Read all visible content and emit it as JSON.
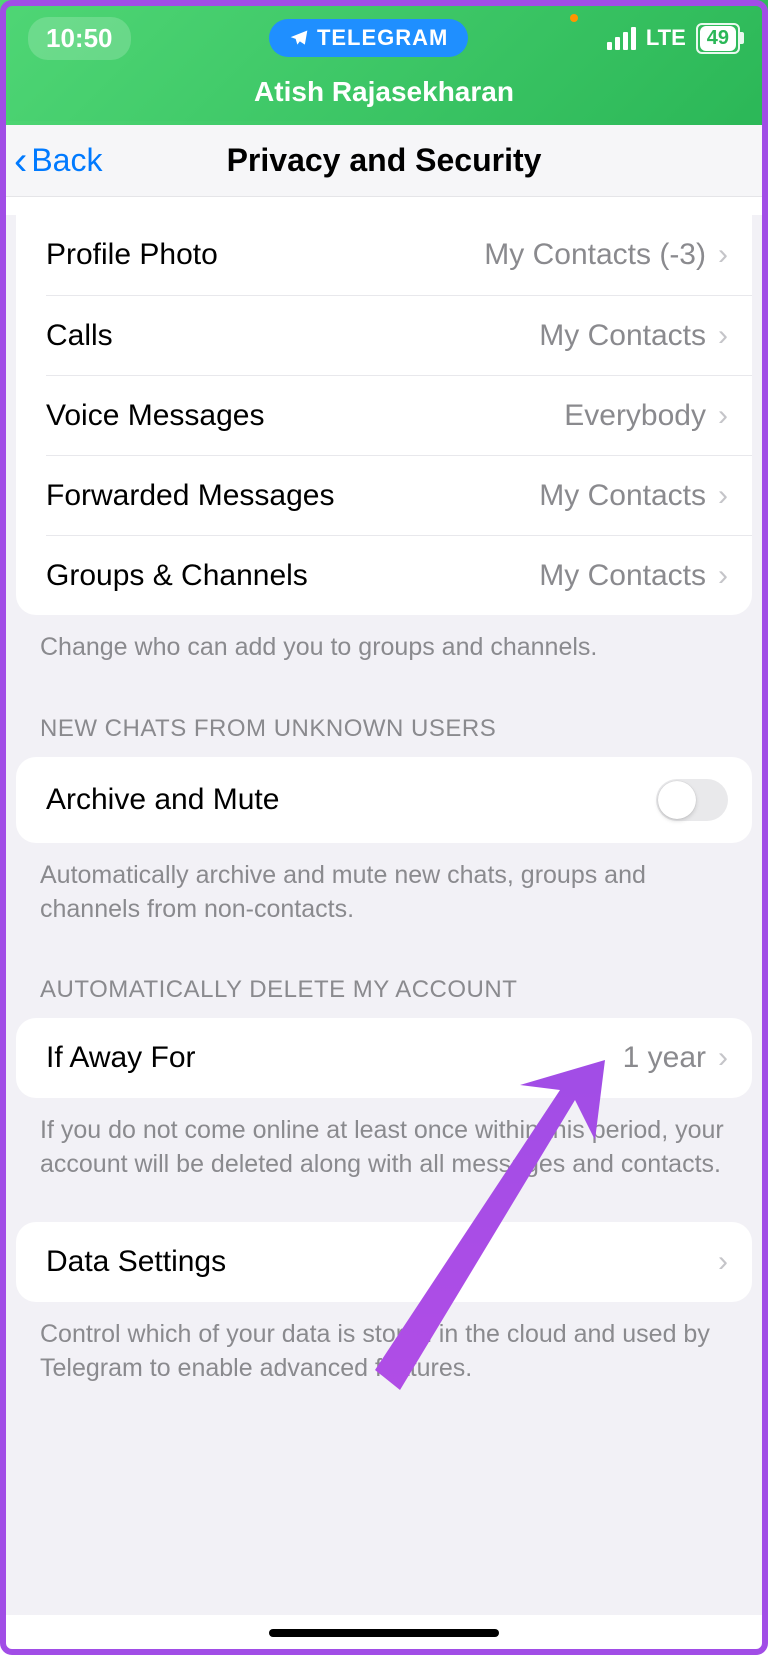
{
  "status": {
    "time": "10:50",
    "app_label": "TELEGRAM",
    "network": "LTE",
    "battery": "49",
    "user": "Atish Rajasekharan"
  },
  "nav": {
    "back": "Back",
    "title": "Privacy and Security"
  },
  "privacy_rows": [
    {
      "label": "Profile Photo",
      "value": "My Contacts (-3)"
    },
    {
      "label": "Calls",
      "value": "My Contacts"
    },
    {
      "label": "Voice Messages",
      "value": "Everybody"
    },
    {
      "label": "Forwarded Messages",
      "value": "My Contacts"
    },
    {
      "label": "Groups & Channels",
      "value": "My Contacts"
    }
  ],
  "privacy_footer": "Change who can add you to groups and channels.",
  "unknown_header": "NEW CHATS FROM UNKNOWN USERS",
  "archive_mute": {
    "label": "Archive and Mute",
    "on": false
  },
  "archive_footer": "Automatically archive and mute new chats, groups and channels from non-contacts.",
  "delete_header": "AUTOMATICALLY DELETE MY ACCOUNT",
  "if_away": {
    "label": "If Away For",
    "value": "1 year"
  },
  "delete_footer": "If you do not come online at least once within this period, your account will be deleted along with all messages and contacts.",
  "data_settings": {
    "label": "Data Settings"
  },
  "data_footer": "Control which of your data is stored in the cloud and used by Telegram to enable advanced features."
}
